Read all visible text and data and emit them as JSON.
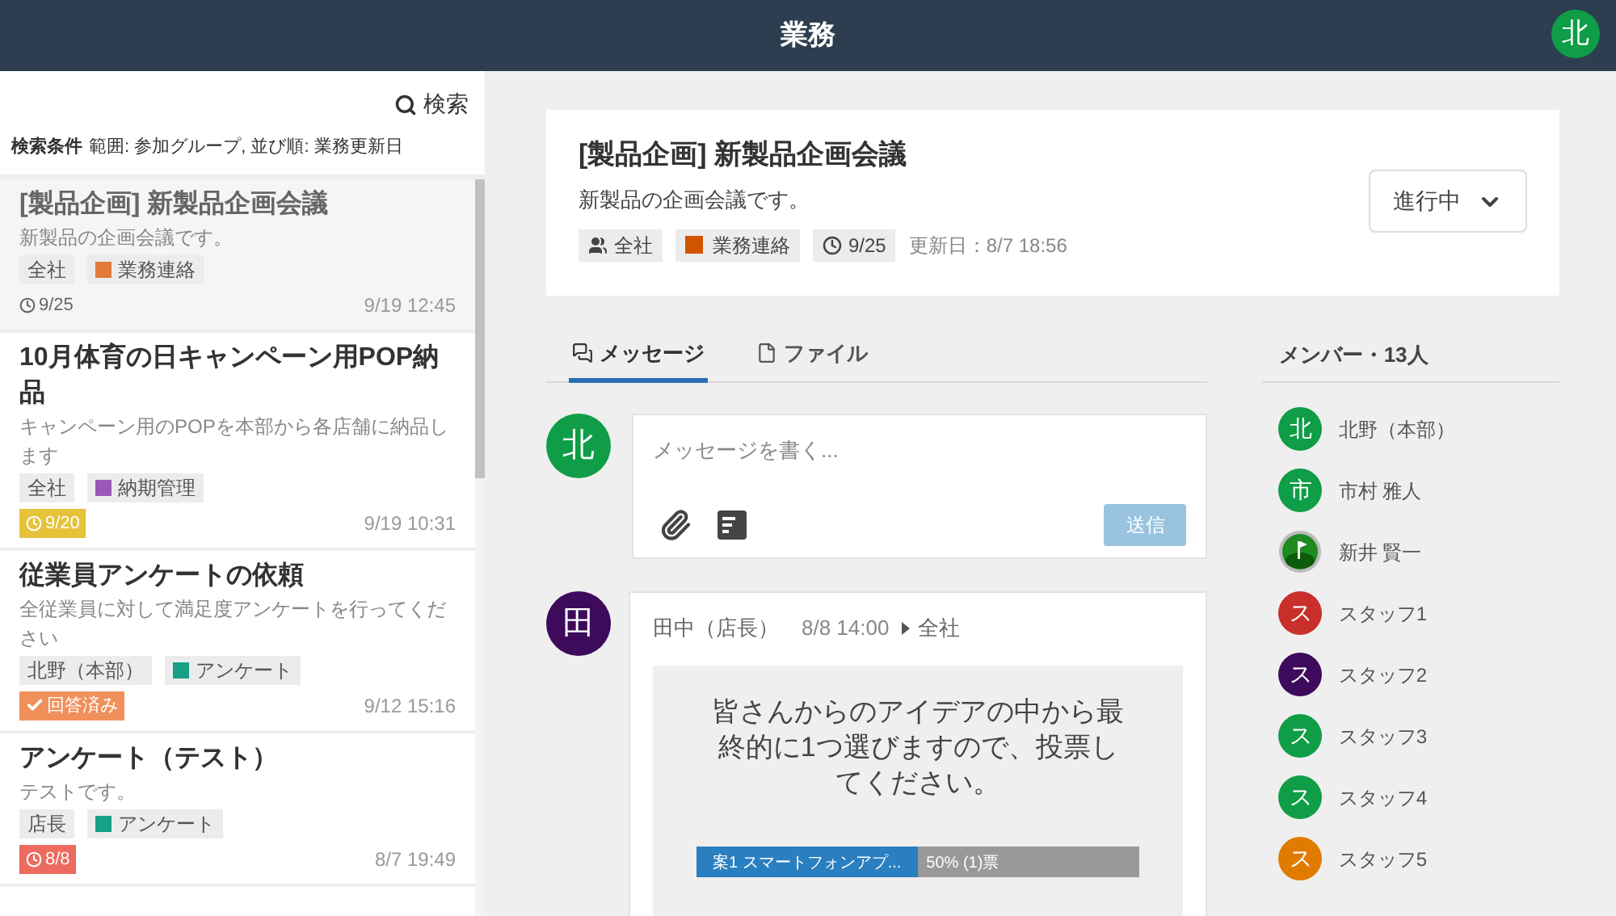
{
  "header": {
    "title": "業務",
    "user_initial": "北"
  },
  "sidebar": {
    "search_label": "検索",
    "conditions_label": "検索条件",
    "conditions": "範囲: 参加グループ, 並び順: 業務更新日",
    "items": [
      {
        "title": "[製品企画] 新製品企画会議",
        "description": "新製品の企画会議です。",
        "group": "全社",
        "category": "業務連絡",
        "color": "#e07b39",
        "badge": {
          "kind": "plain",
          "text": "9/25"
        },
        "updated": "9/19 12:45",
        "selected": true
      },
      {
        "title": "10月体育の日キャンペーン用POP納品",
        "description": "キャンペーン用のPOPを本部から各店舗に納品します",
        "group": "全社",
        "category": "納期管理",
        "color": "#9b59b6",
        "badge": {
          "kind": "soon",
          "text": "9/20"
        },
        "updated": "9/19 10:31",
        "selected": false
      },
      {
        "title": "従業員アンケートの依頼",
        "description": "全従業員に対して満足度アンケートを行ってください",
        "group": "北野（本部）",
        "category": "アンケート",
        "color": "#16a085",
        "badge": {
          "kind": "answered",
          "text": "回答済み"
        },
        "updated": "9/12 15:16",
        "selected": false
      },
      {
        "title": "アンケート（テスト）",
        "description": "テストです。",
        "group": "店長",
        "category": "アンケート",
        "color": "#16a085",
        "badge": {
          "kind": "overdue",
          "text": "8/8"
        },
        "updated": "8/7 19:49",
        "selected": false
      }
    ]
  },
  "task": {
    "title": "[製品企画] 新製品企画会議",
    "description": "新製品の企画会議です。",
    "group": "全社",
    "category": "業務連絡",
    "color": "#d35400",
    "deadline": "9/25",
    "updated": "更新日：8/7 18:56",
    "status": "進行中"
  },
  "tabs": [
    {
      "label": "メッセージ",
      "kind": "messages",
      "selected": true
    },
    {
      "label": "ファイル",
      "kind": "files",
      "selected": false
    }
  ],
  "composer": {
    "avatar": "北",
    "placeholder": "メッセージを書く...",
    "send": "送信",
    "disabled": true
  },
  "post": {
    "avatar": "田",
    "author": "田中（店長）",
    "time": "8/8 14:00",
    "target": "全社",
    "question": "皆さんからのアイデアの中から最終的に1つ選びますので、投票してください。",
    "options": [
      {
        "label": "案1 スマートフォンアプ...",
        "level": 0.5,
        "reading": "50% (1)票"
      }
    ]
  },
  "members": {
    "title": "メンバー・13人",
    "items": [
      {
        "name": "北野（本部）",
        "kind": "initial",
        "initial": "北",
        "color": "#0f9d47"
      },
      {
        "name": "市村 雅人",
        "kind": "initial",
        "initial": "市",
        "color": "#0f9d47"
      },
      {
        "name": "新井 賢一",
        "kind": "picture"
      },
      {
        "name": "スタッフ1",
        "kind": "initial",
        "initial": "ス",
        "color": "#c9302c"
      },
      {
        "name": "スタッフ2",
        "kind": "initial",
        "initial": "ス",
        "color": "#3d0a5c"
      },
      {
        "name": "スタッフ3",
        "kind": "initial",
        "initial": "ス",
        "color": "#0f9d47"
      },
      {
        "name": "スタッフ4",
        "kind": "initial",
        "initial": "ス",
        "color": "#0f9d47"
      },
      {
        "name": "スタッフ5",
        "kind": "initial",
        "initial": "ス",
        "color": "#e07b00"
      }
    ]
  }
}
